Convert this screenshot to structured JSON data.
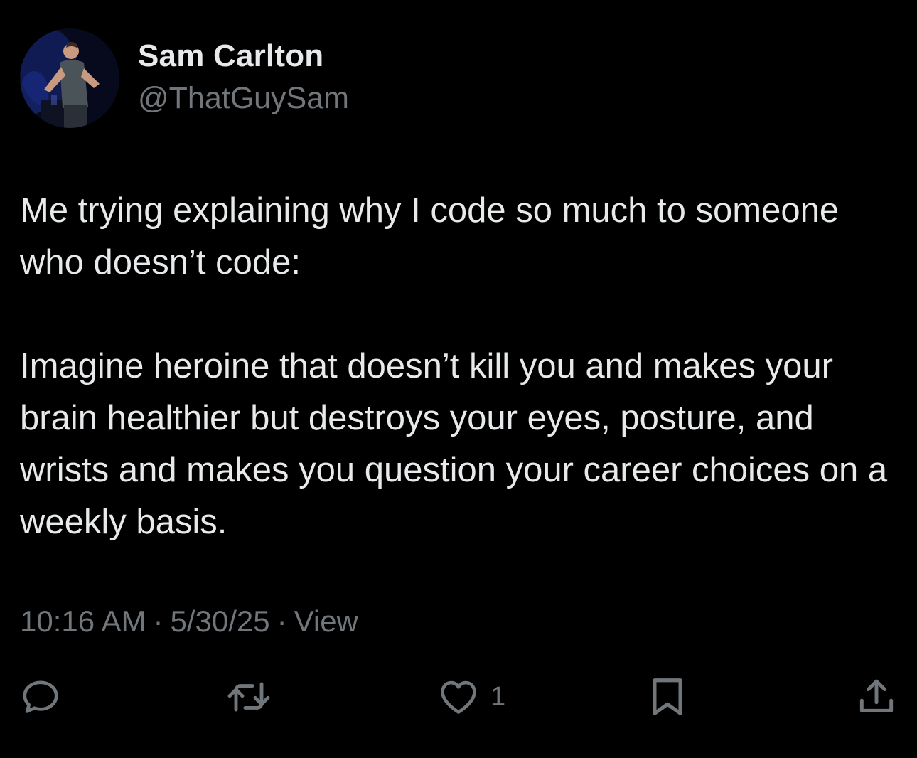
{
  "author": {
    "display_name": "Sam Carlton",
    "handle": "@ThatGuySam",
    "avatar_icon": "profile-photo"
  },
  "tweet": {
    "paragraphs": [
      "Me trying explaining why I code so much to someone who doesn’t code:",
      "Imagine heroine that doesn’t kill you and makes your brain healthier but destroys your eyes, posture, and wrists and makes you question your career choices on a weekly basis."
    ]
  },
  "meta": {
    "time": "10:16 AM",
    "date": "5/30/25",
    "separator": "·",
    "view_label": "View"
  },
  "actions": {
    "reply": {
      "icon": "reply-icon"
    },
    "repost": {
      "icon": "repost-icon"
    },
    "like": {
      "icon": "heart-icon",
      "count": "1"
    },
    "bookmark": {
      "icon": "bookmark-icon"
    },
    "share": {
      "icon": "share-icon"
    }
  },
  "colors": {
    "background": "#000000",
    "primary_text": "#e7e9ea",
    "secondary_text": "#71767b"
  }
}
